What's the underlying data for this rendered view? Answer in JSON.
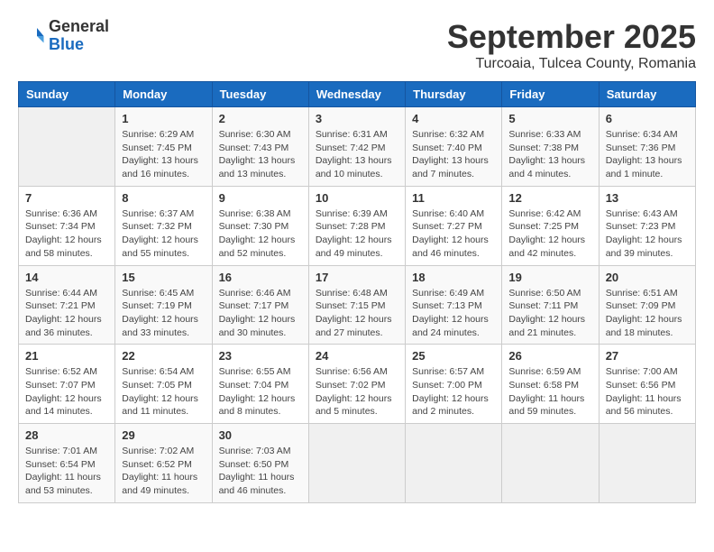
{
  "logo": {
    "general": "General",
    "blue": "Blue"
  },
  "title": "September 2025",
  "location": "Turcoaia, Tulcea County, Romania",
  "weekdays": [
    "Sunday",
    "Monday",
    "Tuesday",
    "Wednesday",
    "Thursday",
    "Friday",
    "Saturday"
  ],
  "weeks": [
    [
      {
        "day": "",
        "info": ""
      },
      {
        "day": "1",
        "info": "Sunrise: 6:29 AM\nSunset: 7:45 PM\nDaylight: 13 hours\nand 16 minutes."
      },
      {
        "day": "2",
        "info": "Sunrise: 6:30 AM\nSunset: 7:43 PM\nDaylight: 13 hours\nand 13 minutes."
      },
      {
        "day": "3",
        "info": "Sunrise: 6:31 AM\nSunset: 7:42 PM\nDaylight: 13 hours\nand 10 minutes."
      },
      {
        "day": "4",
        "info": "Sunrise: 6:32 AM\nSunset: 7:40 PM\nDaylight: 13 hours\nand 7 minutes."
      },
      {
        "day": "5",
        "info": "Sunrise: 6:33 AM\nSunset: 7:38 PM\nDaylight: 13 hours\nand 4 minutes."
      },
      {
        "day": "6",
        "info": "Sunrise: 6:34 AM\nSunset: 7:36 PM\nDaylight: 13 hours\nand 1 minute."
      }
    ],
    [
      {
        "day": "7",
        "info": "Sunrise: 6:36 AM\nSunset: 7:34 PM\nDaylight: 12 hours\nand 58 minutes."
      },
      {
        "day": "8",
        "info": "Sunrise: 6:37 AM\nSunset: 7:32 PM\nDaylight: 12 hours\nand 55 minutes."
      },
      {
        "day": "9",
        "info": "Sunrise: 6:38 AM\nSunset: 7:30 PM\nDaylight: 12 hours\nand 52 minutes."
      },
      {
        "day": "10",
        "info": "Sunrise: 6:39 AM\nSunset: 7:28 PM\nDaylight: 12 hours\nand 49 minutes."
      },
      {
        "day": "11",
        "info": "Sunrise: 6:40 AM\nSunset: 7:27 PM\nDaylight: 12 hours\nand 46 minutes."
      },
      {
        "day": "12",
        "info": "Sunrise: 6:42 AM\nSunset: 7:25 PM\nDaylight: 12 hours\nand 42 minutes."
      },
      {
        "day": "13",
        "info": "Sunrise: 6:43 AM\nSunset: 7:23 PM\nDaylight: 12 hours\nand 39 minutes."
      }
    ],
    [
      {
        "day": "14",
        "info": "Sunrise: 6:44 AM\nSunset: 7:21 PM\nDaylight: 12 hours\nand 36 minutes."
      },
      {
        "day": "15",
        "info": "Sunrise: 6:45 AM\nSunset: 7:19 PM\nDaylight: 12 hours\nand 33 minutes."
      },
      {
        "day": "16",
        "info": "Sunrise: 6:46 AM\nSunset: 7:17 PM\nDaylight: 12 hours\nand 30 minutes."
      },
      {
        "day": "17",
        "info": "Sunrise: 6:48 AM\nSunset: 7:15 PM\nDaylight: 12 hours\nand 27 minutes."
      },
      {
        "day": "18",
        "info": "Sunrise: 6:49 AM\nSunset: 7:13 PM\nDaylight: 12 hours\nand 24 minutes."
      },
      {
        "day": "19",
        "info": "Sunrise: 6:50 AM\nSunset: 7:11 PM\nDaylight: 12 hours\nand 21 minutes."
      },
      {
        "day": "20",
        "info": "Sunrise: 6:51 AM\nSunset: 7:09 PM\nDaylight: 12 hours\nand 18 minutes."
      }
    ],
    [
      {
        "day": "21",
        "info": "Sunrise: 6:52 AM\nSunset: 7:07 PM\nDaylight: 12 hours\nand 14 minutes."
      },
      {
        "day": "22",
        "info": "Sunrise: 6:54 AM\nSunset: 7:05 PM\nDaylight: 12 hours\nand 11 minutes."
      },
      {
        "day": "23",
        "info": "Sunrise: 6:55 AM\nSunset: 7:04 PM\nDaylight: 12 hours\nand 8 minutes."
      },
      {
        "day": "24",
        "info": "Sunrise: 6:56 AM\nSunset: 7:02 PM\nDaylight: 12 hours\nand 5 minutes."
      },
      {
        "day": "25",
        "info": "Sunrise: 6:57 AM\nSunset: 7:00 PM\nDaylight: 12 hours\nand 2 minutes."
      },
      {
        "day": "26",
        "info": "Sunrise: 6:59 AM\nSunset: 6:58 PM\nDaylight: 11 hours\nand 59 minutes."
      },
      {
        "day": "27",
        "info": "Sunrise: 7:00 AM\nSunset: 6:56 PM\nDaylight: 11 hours\nand 56 minutes."
      }
    ],
    [
      {
        "day": "28",
        "info": "Sunrise: 7:01 AM\nSunset: 6:54 PM\nDaylight: 11 hours\nand 53 minutes."
      },
      {
        "day": "29",
        "info": "Sunrise: 7:02 AM\nSunset: 6:52 PM\nDaylight: 11 hours\nand 49 minutes."
      },
      {
        "day": "30",
        "info": "Sunrise: 7:03 AM\nSunset: 6:50 PM\nDaylight: 11 hours\nand 46 minutes."
      },
      {
        "day": "",
        "info": ""
      },
      {
        "day": "",
        "info": ""
      },
      {
        "day": "",
        "info": ""
      },
      {
        "day": "",
        "info": ""
      }
    ]
  ]
}
